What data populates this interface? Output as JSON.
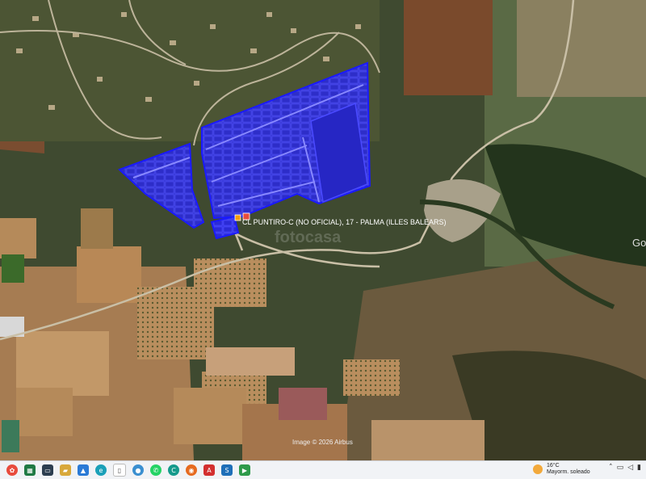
{
  "map": {
    "place_label": "CL PUNTIRO-C (NO OFICIAL), 17 - PALMA (ILLES BALEARS)",
    "watermark": "fotocasa",
    "imagery_credit": "Image © 2026 Airbus",
    "provider_partial": "Go",
    "overlay_color": "#1a1aff",
    "marker_color": "#f39c12"
  },
  "taskbar": {
    "weather_temp": "16°C",
    "weather_desc": "Mayorm. soleado",
    "apps": [
      "start-icon",
      "excel-icon",
      "file-explorer-icon",
      "folder-icon",
      "photos-icon",
      "edge-icon",
      "files-icon",
      "chrome-icon",
      "whatsapp-icon",
      "chrome-alt-icon",
      "firefox-icon",
      "acrobat-icon",
      "sway-icon",
      "project-icon"
    ]
  }
}
